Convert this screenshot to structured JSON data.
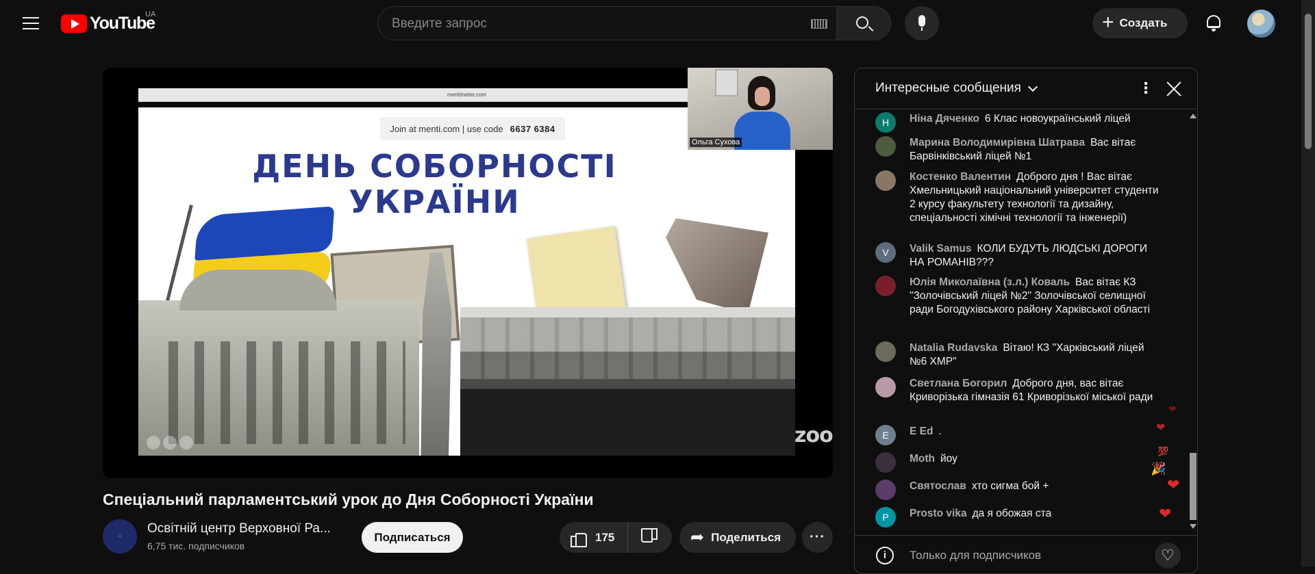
{
  "header": {
    "logo_text": "YouTube",
    "country_code": "UA",
    "search_placeholder": "Введите запрос",
    "create_label": "Создать"
  },
  "video": {
    "title": "Спеціальний парламентський урок до Дня Соборності України",
    "slide": {
      "url": "mentimeter.com",
      "join_text": "Join at menti.com | use code",
      "join_code": "6637 6384",
      "title_line1": "ДЕНЬ СОБОРНОСТІ",
      "title_line2": "УКРАЇНИ"
    },
    "speaker_name": "Ольга Сухова",
    "watermark": "zoom"
  },
  "channel": {
    "name": "Освітній центр Верховної Ра...",
    "subscribers": "6,75 тис. подписчиков",
    "subscribe_label": "Подписаться"
  },
  "actions": {
    "likes": "175",
    "share_label": "Поделиться"
  },
  "chat": {
    "mode_label": "Интересные сообщения",
    "footer_text": "Только для подписчиков",
    "messages": [
      {
        "author": "Ніна Дяченко",
        "text": "6 Клас новоукраїнський ліцей",
        "initial": "Н",
        "color": "#0b7d6e"
      },
      {
        "author": "Марина Володимирівна Шатрава",
        "text": "Вас вітає Барвінківський ліцей №1",
        "initial": "",
        "color": "#4f5b3e"
      },
      {
        "author": "Костенко Валентин",
        "text": "Доброго дня ! Вас вітає Хмельницький національний університет студенти 2 курсу факультету технології та дизайну, спеціальності хімічні технології та інженерії)",
        "initial": "",
        "color": "#8a7665"
      },
      {
        "author": "Valik Samus",
        "text": "КОЛИ БУДУТЬ ЛЮДСЬКІ ДОРОГИ НА РОМАНІВ???",
        "initial": "V",
        "color": "#5d6d7e"
      },
      {
        "author": "Юлія Миколаївна (з.л.) Коваль",
        "text": "Вас вітає КЗ \"Золочівський ліцей №2\" Золочівської селищної ради Богодухівського району Харківської області",
        "initial": "",
        "color": "#7a1f2a"
      },
      {
        "author": "Natalia Rudavska",
        "text": "Вітаю! КЗ \"Харківський ліцей №6 ХМР\"",
        "initial": "",
        "color": "#6e6a5c"
      },
      {
        "author": "Светлана Богорил",
        "text": "Доброго дня, вас вітає Криворізька гімназія 61 Криворізької міської ради",
        "initial": "",
        "color": "#b89aa8"
      },
      {
        "author": "E Ed",
        "text": ".",
        "initial": "E",
        "color": "#6e7f8f"
      },
      {
        "author": "Moth",
        "text": "йоу",
        "initial": "",
        "color": "#3b2f3f"
      },
      {
        "author": "Святослав",
        "text": "хто сигма бой +",
        "initial": "",
        "color": "#5c3c6a"
      },
      {
        "author": "Prosto vika",
        "text": "да я обожая ста",
        "initial": "P",
        "color": "#0096a6"
      }
    ]
  }
}
